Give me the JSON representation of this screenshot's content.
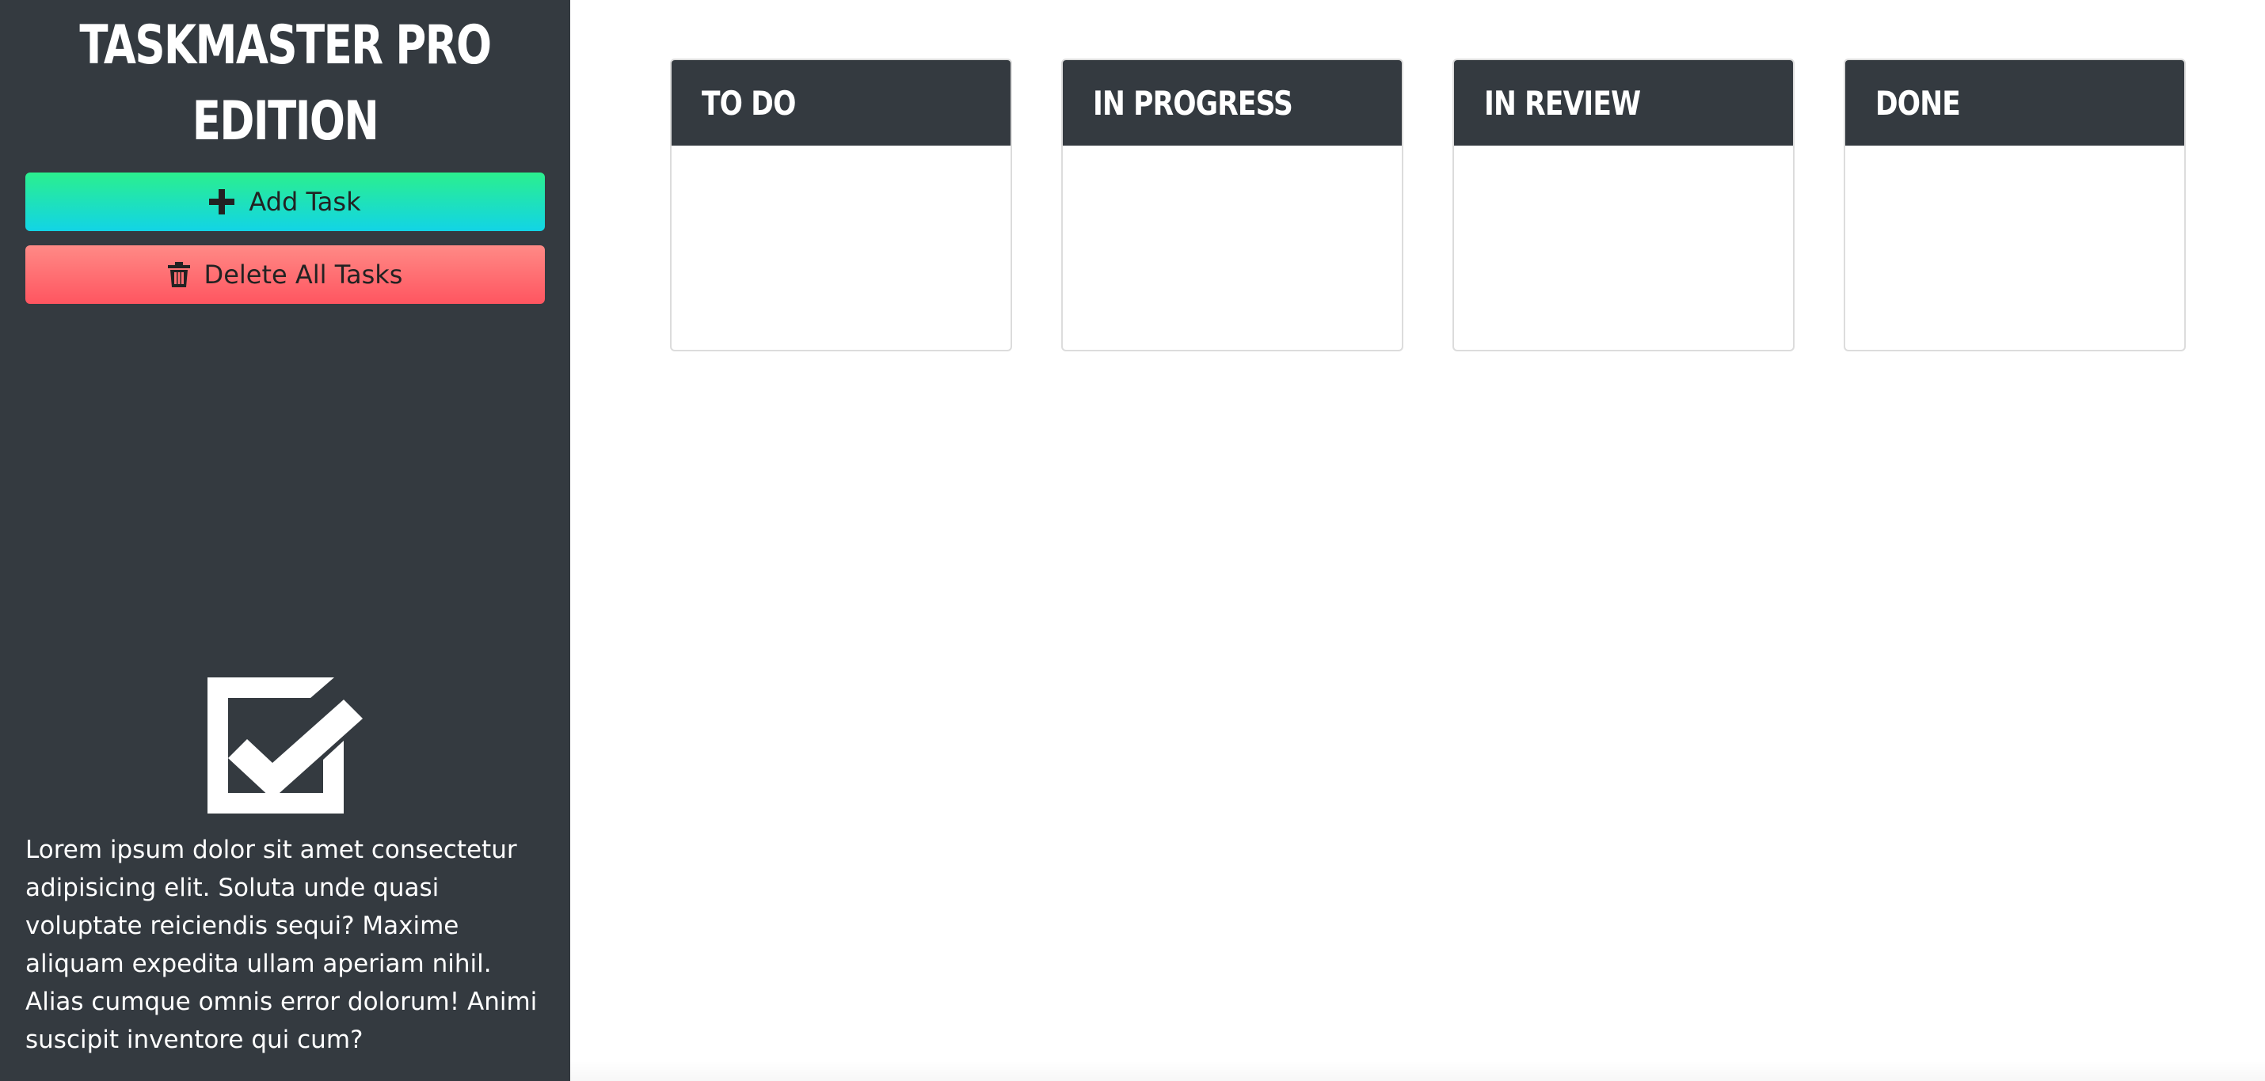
{
  "app": {
    "title": "TASKMASTER PRO EDITION"
  },
  "sidebar": {
    "add_task_label": "Add Task",
    "delete_all_label": "Delete All Tasks",
    "add_icon": "plus-icon",
    "delete_icon": "trash-icon",
    "logo_icon": "checkbox-checked-icon",
    "description": "Lorem ipsum dolor sit amet consectetur adipisicing elit. Soluta unde quasi voluptate reiciendis sequi? Maxime aliquam expedita ullam aperiam nihil. Alias cumque omnis error dolorum! Animi suscipit inventore qui cum?"
  },
  "board": {
    "columns": [
      {
        "title": "TO DO"
      },
      {
        "title": "IN PROGRESS"
      },
      {
        "title": "IN REVIEW"
      },
      {
        "title": "DONE"
      }
    ]
  },
  "colors": {
    "sidebar_bg": "#343a40",
    "add_button_top": "#2bef8e",
    "add_button_bottom": "#12d4e6",
    "delete_button_top": "#ff8a86",
    "delete_button_bottom": "#ff5560",
    "column_header_bg": "#343a40"
  }
}
